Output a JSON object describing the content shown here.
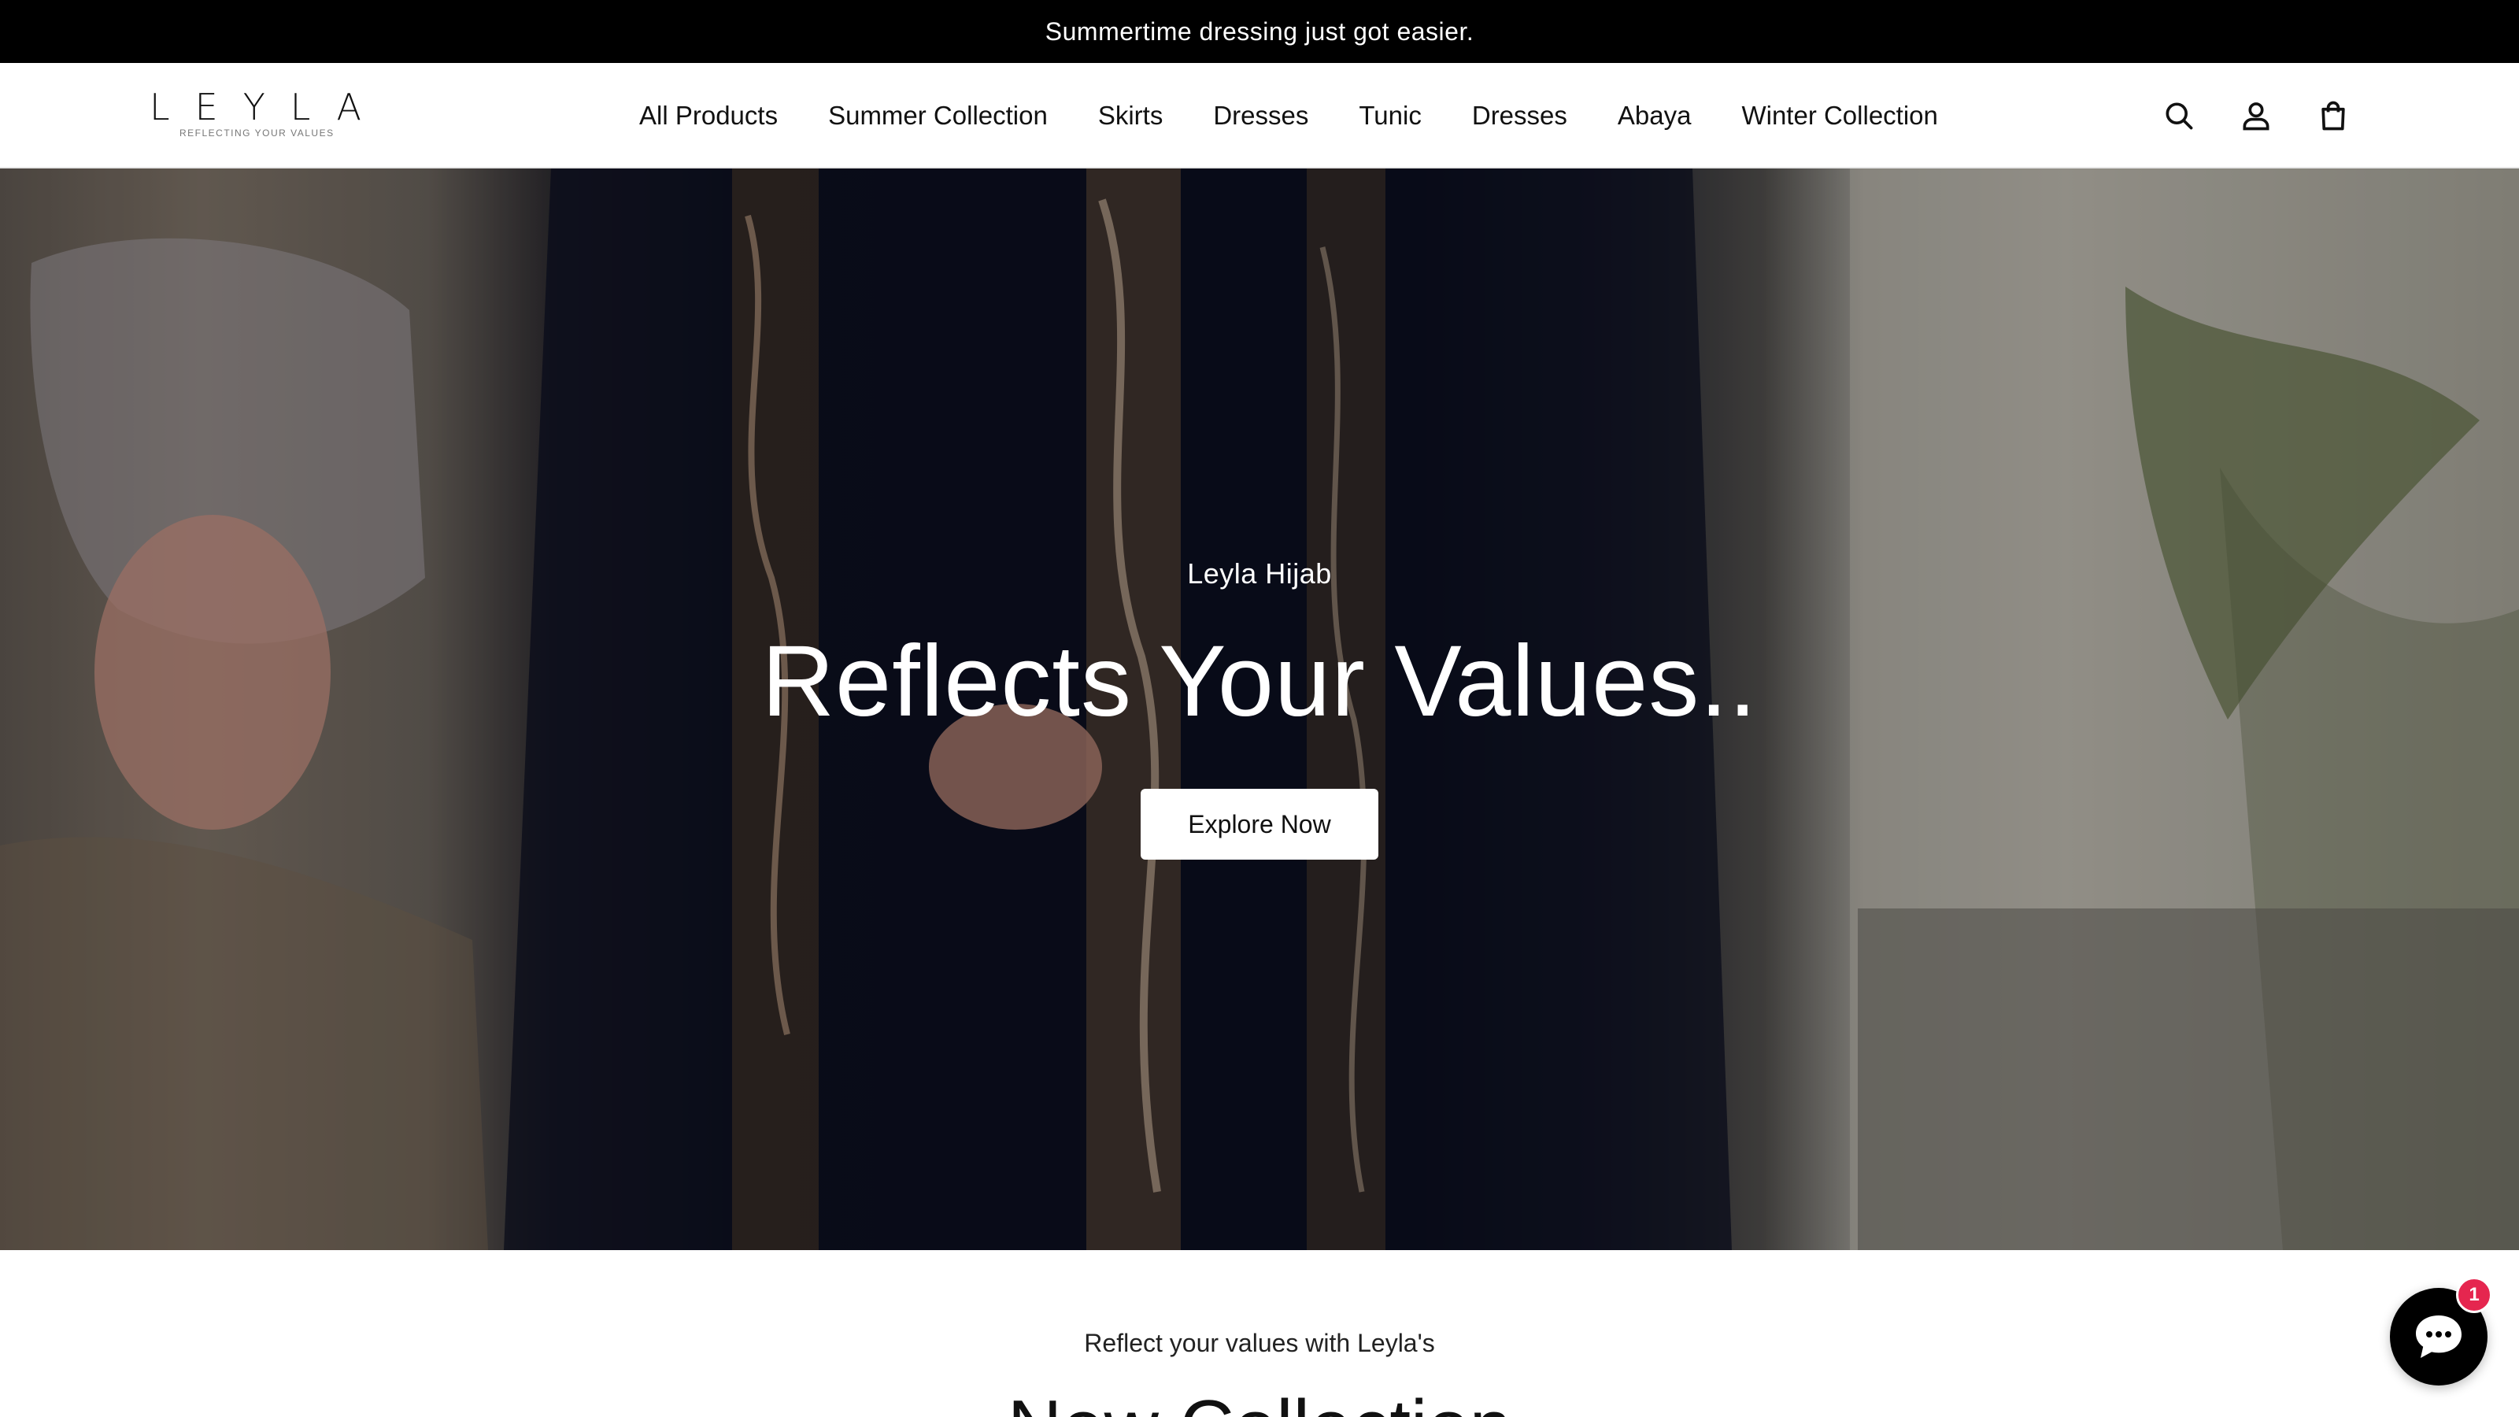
{
  "announcement": {
    "text": "Summertime dressing just got easier."
  },
  "header": {
    "logo": {
      "wordmark": "LEYLA",
      "tagline": "REFLECTING YOUR VALUES"
    },
    "nav": [
      {
        "label": "All Products"
      },
      {
        "label": "Summer Collection"
      },
      {
        "label": "Skirts"
      },
      {
        "label": "Dresses"
      },
      {
        "label": "Tunic"
      },
      {
        "label": "Dresses"
      },
      {
        "label": "Abaya"
      },
      {
        "label": "Winter Collection"
      }
    ],
    "icons": {
      "search": "search-icon",
      "account": "user-icon",
      "cart": "shopping-bag-icon"
    }
  },
  "hero": {
    "eyebrow": "Leyla Hijab",
    "title": "Reflects Your Values..",
    "button": "Explore Now"
  },
  "intro": {
    "subtitle": "Reflect your values with Leyla's",
    "title": "New Collection"
  },
  "chat_widget": {
    "icon": "chat-bubble-icon",
    "badge_count": "1",
    "badge_color": "#e5264f"
  },
  "colors": {
    "announcement_bg": "#000000",
    "button_bg": "#ffffff",
    "text": "#111111"
  }
}
